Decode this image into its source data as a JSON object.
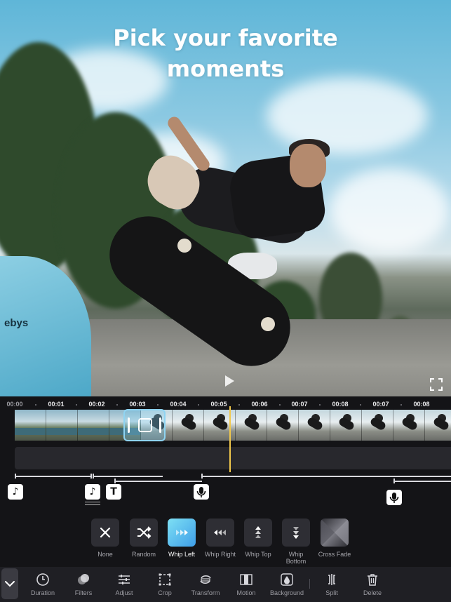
{
  "headline": {
    "line1": "Pick your favorite",
    "line2": "moments"
  },
  "preview": {
    "ramp_text": "ebys"
  },
  "timeline": {
    "ticks": [
      "00:00",
      "00:01",
      "00:02",
      "00:03",
      "00:04",
      "00:05",
      "00:06",
      "00:07",
      "00:08",
      "00:07",
      "00:08"
    ],
    "playhead_time": "00:05"
  },
  "tracks": {
    "music_chip": "♪",
    "music_chip_2": "♪",
    "text_chip": "T"
  },
  "transitions": {
    "selected": "Whip Left",
    "items": [
      {
        "label": "None",
        "icon": "close-icon"
      },
      {
        "label": "Random",
        "icon": "shuffle-icon"
      },
      {
        "label": "Whip Left",
        "icon": "whip-left-icon"
      },
      {
        "label": "Whip Right",
        "icon": "whip-right-icon"
      },
      {
        "label": "Whip Top",
        "icon": "whip-top-icon"
      },
      {
        "label": "Whip Bottom",
        "icon": "whip-bottom-icon"
      },
      {
        "label": "Cross Fade",
        "icon": "cross-fade-icon"
      }
    ]
  },
  "toolbar": {
    "items": [
      {
        "label": "Duration",
        "icon": "clock-icon"
      },
      {
        "label": "Filters",
        "icon": "filters-icon"
      },
      {
        "label": "Adjust",
        "icon": "sliders-icon"
      },
      {
        "label": "Crop",
        "icon": "crop-icon"
      },
      {
        "label": "Transform",
        "icon": "transform-icon"
      },
      {
        "label": "Motion",
        "icon": "motion-icon"
      },
      {
        "label": "Background",
        "icon": "background-icon"
      },
      {
        "label": "Split",
        "icon": "split-icon"
      },
      {
        "label": "Delete",
        "icon": "trash-icon"
      }
    ]
  },
  "colors": {
    "accent": "#3e9ee8",
    "playhead": "#f2c94c",
    "panel": "#141417",
    "toolbar": "#1f1f24"
  }
}
